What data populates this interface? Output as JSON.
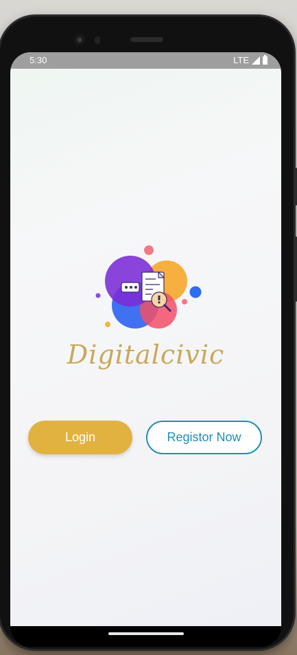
{
  "status_bar": {
    "time": "5:30",
    "network": "LTE"
  },
  "brand": {
    "name": "Digitalcivic"
  },
  "buttons": {
    "login": "Login",
    "register": "Registor Now"
  },
  "colors": {
    "login_bg": "#e1b23f",
    "register_accent": "#1f8fb3",
    "brand_text": "#c9a85a"
  },
  "icons": [
    "signal-icon",
    "battery-icon",
    "app-logo"
  ]
}
